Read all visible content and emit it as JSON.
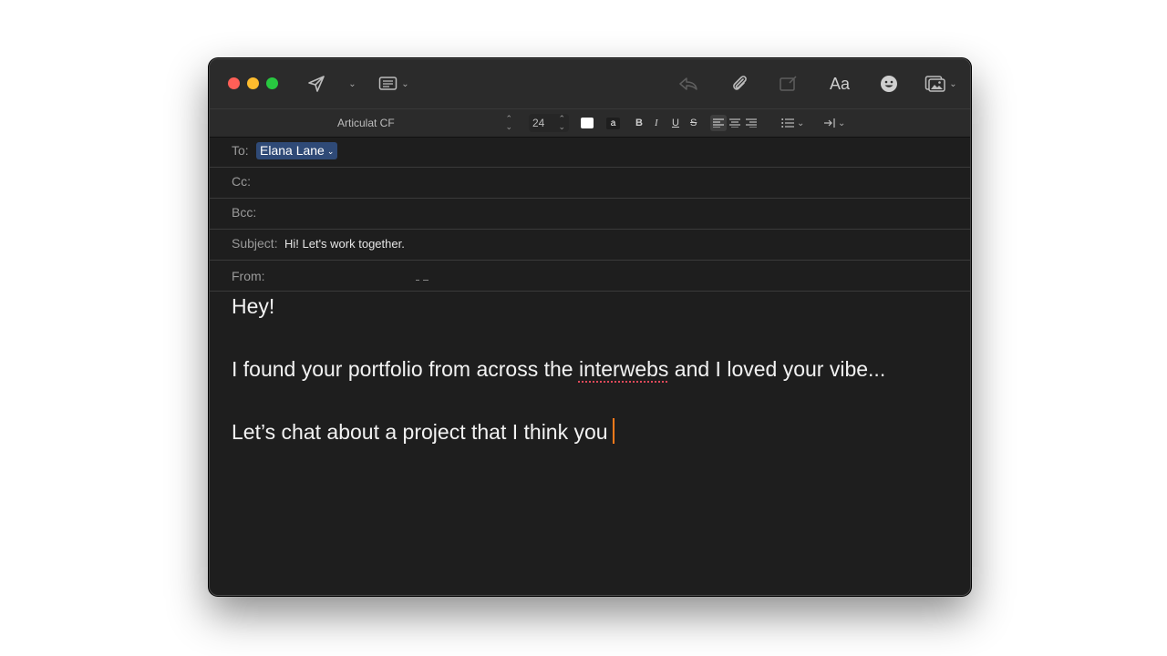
{
  "toolbar": {
    "font_name": "Articulat CF",
    "font_size": "24",
    "highlight_glyph": "a",
    "bold": "B",
    "italic": "I",
    "underline": "U",
    "strikethrough": "S",
    "font_panel_label": "Aa",
    "icons": [
      "send-icon",
      "header-fields-icon",
      "reply-icon",
      "paperclip-icon",
      "markup-icon",
      "font-panel-icon",
      "emoji-icon",
      "photo-browser-icon"
    ]
  },
  "headers": {
    "to_label": "To:",
    "to_recipient": "Elana Lane",
    "cc_label": "Cc:",
    "bcc_label": "Bcc:",
    "subject_label": "Subject:",
    "subject_value": "Hi! Let's work together.",
    "from_label": "From:"
  },
  "body": {
    "line1": "Hey!",
    "line2_before": "I found your portfolio from across the ",
    "line2_misspelled": "interwebs",
    "line2_after": " and I loved your vibe...",
    "line3": "Let’s chat about a project that I think you"
  },
  "colors": {
    "window_bg": "#1e1e1e",
    "toolbar_bg": "#2b2b2b",
    "recipient_token": "#2f4a77",
    "cursor": "#ff7a1a",
    "spellcheck": "#e0495a"
  }
}
